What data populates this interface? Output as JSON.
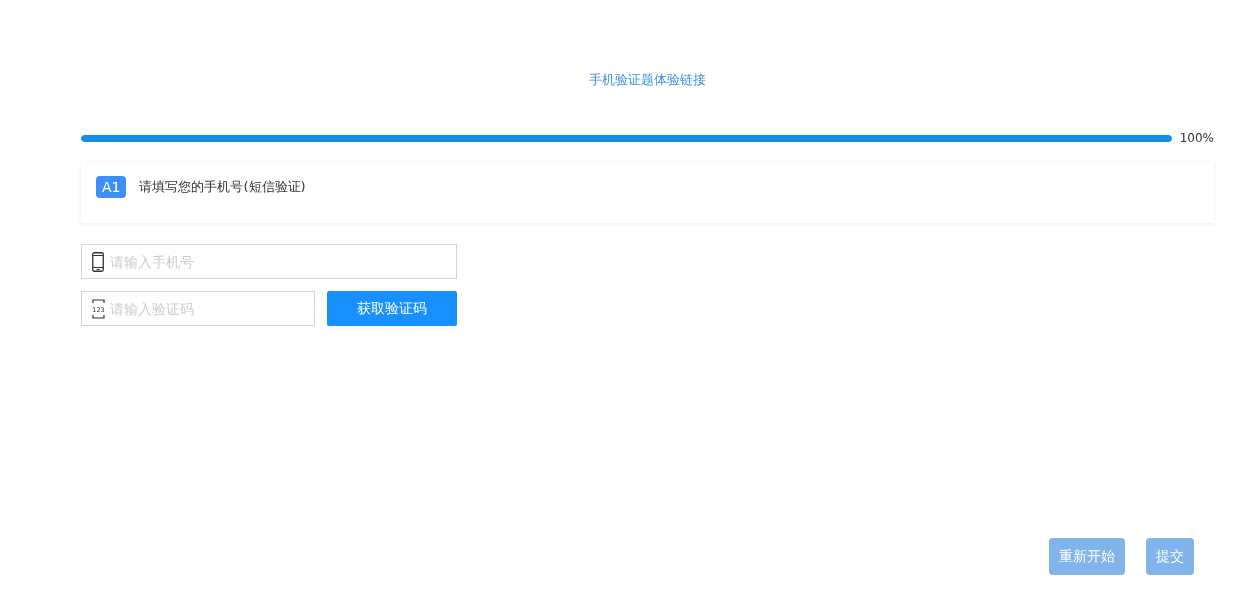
{
  "header": {
    "title": "手机验证题体验链接"
  },
  "progress": {
    "level": 1,
    "reading": "100%"
  },
  "question": {
    "badge": "A1",
    "text": "请填写您的手机号(短信验证)"
  },
  "fields": [
    {
      "kind": "phone",
      "placeholder": "请输入手机号"
    },
    {
      "kind": "code",
      "placeholder": "请输入验证码",
      "icon_text": "123",
      "button": "获取验证码"
    }
  ],
  "footer_buttons": [
    "重新开始",
    "提交"
  ]
}
